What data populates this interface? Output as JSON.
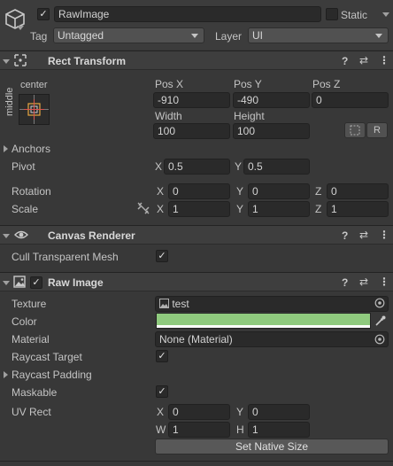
{
  "header": {
    "object_name": "RawImage",
    "active": true,
    "static_label": "Static",
    "static_checked": false,
    "tag_label": "Tag",
    "tag_value": "Untagged",
    "layer_label": "Layer",
    "layer_value": "UI"
  },
  "rect_transform": {
    "title": "Rect Transform",
    "anchor_preset_h": "center",
    "anchor_preset_v": "middle",
    "pos_x_label": "Pos X",
    "pos_y_label": "Pos Y",
    "pos_z_label": "Pos Z",
    "pos_x": "-910",
    "pos_y": "-490",
    "pos_z": "0",
    "width_label": "Width",
    "height_label": "Height",
    "width": "100",
    "height": "100",
    "raw_button": "R",
    "anchors_label": "Anchors",
    "pivot_label": "Pivot",
    "pivot_x": "0.5",
    "pivot_y": "0.5",
    "rotation_label": "Rotation",
    "rotation": {
      "x": "0",
      "y": "0",
      "z": "0"
    },
    "scale_label": "Scale",
    "scale": {
      "x": "1",
      "y": "1",
      "z": "1"
    }
  },
  "axes": {
    "x": "X",
    "y": "Y",
    "z": "Z",
    "w": "W",
    "h": "H"
  },
  "canvas_renderer": {
    "title": "Canvas Renderer",
    "cull_label": "Cull Transparent Mesh",
    "cull_checked": true
  },
  "raw_image": {
    "title": "Raw Image",
    "enabled": true,
    "texture_label": "Texture",
    "texture_value": "test",
    "color_label": "Color",
    "color_value": "#8fca7e",
    "material_label": "Material",
    "material_value": "None (Material)",
    "raycast_target_label": "Raycast Target",
    "raycast_target_checked": true,
    "raycast_padding_label": "Raycast Padding",
    "maskable_label": "Maskable",
    "maskable_checked": true,
    "uv_rect_label": "UV Rect",
    "uv": {
      "x": "0",
      "y": "0",
      "w": "1",
      "h": "1"
    },
    "native_size_button": "Set Native Size"
  },
  "icons": {
    "checkmark": "✓",
    "help": "?",
    "presets": "⇄",
    "menu": "⋮"
  }
}
